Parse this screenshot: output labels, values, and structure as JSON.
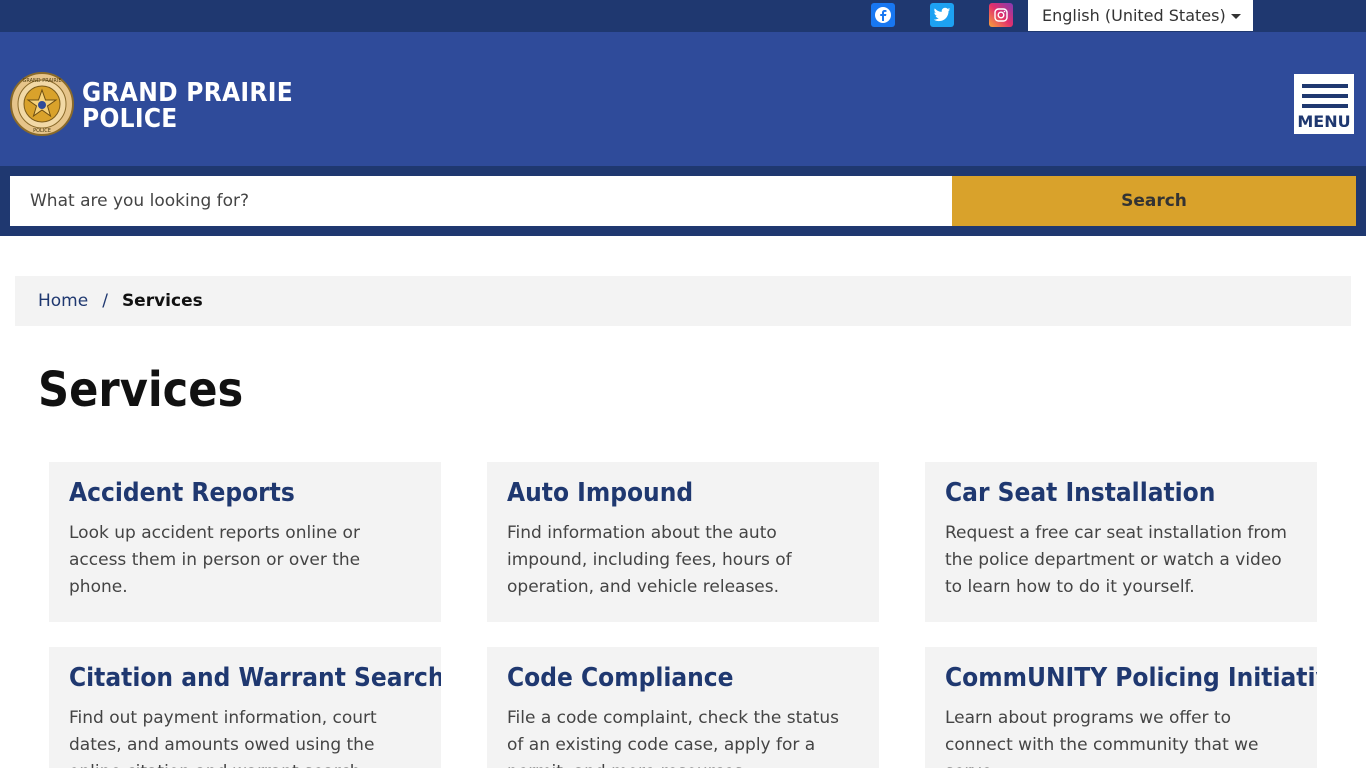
{
  "topbar": {
    "social": [
      {
        "name": "facebook",
        "icon": "facebook-icon"
      },
      {
        "name": "twitter",
        "icon": "twitter-icon"
      },
      {
        "name": "instagram",
        "icon": "instagram-icon"
      }
    ],
    "language": "English (United States)"
  },
  "header": {
    "brand_line1": "GRAND PRAIRIE",
    "brand_line2": "POLICE",
    "menu_label": "MENU",
    "logo": "grand-prairie-police-badge",
    "badge_text_top": "GRAND PRAIRIE",
    "badge_text_bottom": "POLICE"
  },
  "search": {
    "placeholder": "What are you looking for?",
    "button_label": "Search"
  },
  "breadcrumb": {
    "home": "Home",
    "separator": "/",
    "current": "Services"
  },
  "page": {
    "title": "Services"
  },
  "cards": [
    {
      "title": "Accident Reports",
      "description": "Look up accident reports online or access them in person or over the phone."
    },
    {
      "title": "Auto Impound",
      "description": "Find information about the auto impound, including fees, hours of operation, and vehicle releases."
    },
    {
      "title": "Car Seat Installation",
      "description": "Request a free car seat installation from the police department or watch a video to learn how to do it yourself."
    },
    {
      "title": "Citation and Warrant Search",
      "description": "Find out payment information, court dates, and amounts owed using the online citation and warrant search."
    },
    {
      "title": "Code Compliance",
      "description": "File a code complaint, check the status of an existing code case, apply for a permit, and more resources."
    },
    {
      "title": "CommUNITY Policing Initiatives",
      "description": "Learn about programs we offer to connect with the community that we serve."
    }
  ],
  "colors": {
    "topbar": "#1f3870",
    "header": "#2f4b9a",
    "accent": "#d9a22b",
    "card_bg": "#f3f3f3",
    "heading": "#1f3870"
  }
}
